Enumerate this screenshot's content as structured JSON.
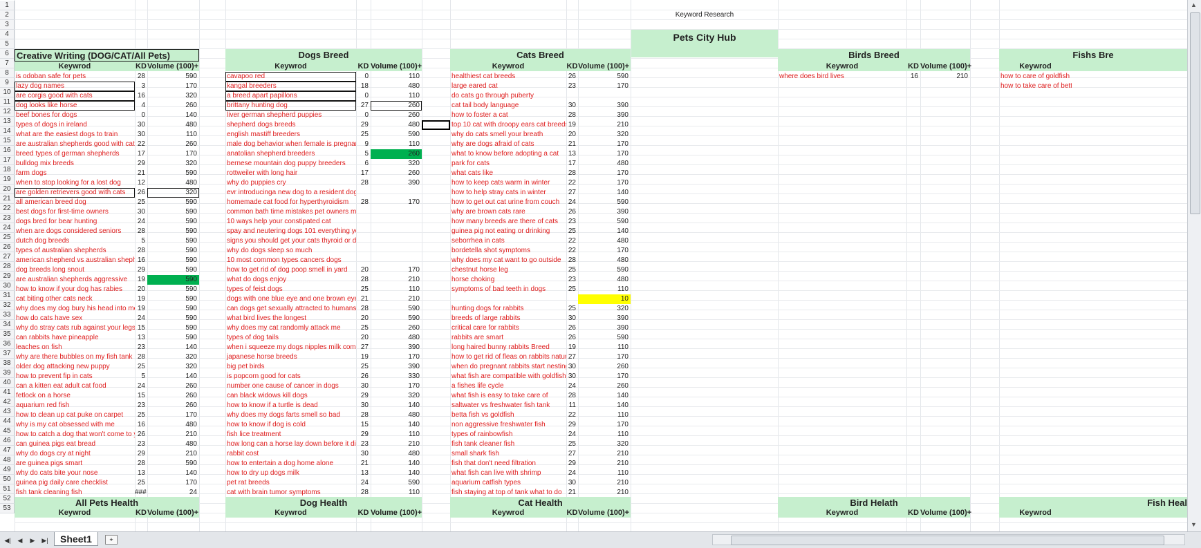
{
  "sheet": {
    "label": "Keyword Research",
    "site": "Pets City Hub",
    "tab": "Sheet1",
    "headers": [
      "Keywrod",
      "KD",
      "Volume (100)+"
    ],
    "sections_top": [
      "Creative Writing (DOG/CAT/All Pets)",
      "Dogs Breed",
      "Cats Breed",
      "Birds Breed",
      "Fishs Bre"
    ],
    "sections_bottom": [
      "All Pets Health",
      "Dog Health",
      "Cat Health",
      "Bird Helath",
      "Fish Heal"
    ],
    "footer_headers": [
      "Keywrod",
      "KD",
      "Volume (100)+"
    ],
    "rows": [
      "1",
      "2",
      "3",
      "4",
      "5",
      "6",
      "7",
      "8",
      "9",
      "10",
      "11",
      "12",
      "13",
      "14",
      "15",
      "16",
      "17",
      "18",
      "19",
      "20",
      "21",
      "22",
      "23",
      "24",
      "25",
      "26",
      "27",
      "28",
      "29",
      "30",
      "31",
      "32",
      "33",
      "34",
      "35",
      "36",
      "37",
      "38",
      "39",
      "40",
      "41",
      "42",
      "43",
      "44",
      "45",
      "46",
      "47",
      "48",
      "49",
      "50",
      "51",
      "52",
      "53"
    ]
  },
  "colors": {
    "header_fill": "#c6efce",
    "keyword_text": "#e02020",
    "green_fill": "#00b050",
    "yellow_fill": "#ffff00"
  },
  "icons": {
    "nav_first": "◀|",
    "nav_prev": "◀",
    "nav_next": "▶",
    "nav_last": "▶|",
    "new_sheet": "new-sheet-icon"
  },
  "columns": {
    "creative": [
      [
        "is odoban safe for pets",
        "28",
        "590"
      ],
      [
        "lazy dog names",
        "3",
        "170"
      ],
      [
        "are corgis good with cats",
        "16",
        "320"
      ],
      [
        "dog looks like horse",
        "4",
        "260"
      ],
      [
        "beef bones for dogs",
        "0",
        "140"
      ],
      [
        "types of dogs in ireland",
        "30",
        "480"
      ],
      [
        "what are the easiest dogs to train",
        "30",
        "110"
      ],
      [
        "are australian shepherds good with cats",
        "22",
        "260"
      ],
      [
        "breed types of german shepherds",
        "17",
        "170"
      ],
      [
        "bulldog mix breeds",
        "29",
        "320"
      ],
      [
        "farm dogs",
        "21",
        "590"
      ],
      [
        "when to stop looking for a lost dog",
        "12",
        "480"
      ],
      [
        "are golden retrievers good with cats",
        "26",
        "320"
      ],
      [
        "all american breed dog",
        "25",
        "590"
      ],
      [
        "best dogs for first-time owners",
        "30",
        "590"
      ],
      [
        "dogs bred for bear hunting",
        "24",
        "590"
      ],
      [
        "when are dogs considered seniors",
        "28",
        "590"
      ],
      [
        "dutch dog breeds",
        "5",
        "590"
      ],
      [
        "types of australian shepherds",
        "28",
        "590"
      ],
      [
        "american shepherd vs australian shephe",
        "16",
        "590"
      ],
      [
        "dog breeds long snout",
        "29",
        "590"
      ],
      [
        "are australian shepherds aggressive",
        "19",
        "590"
      ],
      [
        "how to know if your dog has rabies",
        "20",
        "590"
      ],
      [
        "cat biting other cats neck",
        "19",
        "590"
      ],
      [
        "why does my dog bury his head into me",
        "19",
        "590"
      ],
      [
        "how do cats have sex",
        "24",
        "590"
      ],
      [
        "why do stray cats rub against your legs",
        "15",
        "590"
      ],
      [
        "can rabbits have pineapple",
        "13",
        "590"
      ],
      [
        "leaches on fish",
        "23",
        "140"
      ],
      [
        "why are there bubbles on my fish tank",
        "28",
        "320"
      ],
      [
        "older dog attacking new puppy",
        "25",
        "320"
      ],
      [
        "how to prevent fip in cats",
        "5",
        "140"
      ],
      [
        "can a kitten eat adult cat food",
        "24",
        "260"
      ],
      [
        "fetlock on a horse",
        "15",
        "260"
      ],
      [
        "aquarium red fish",
        "23",
        "260"
      ],
      [
        "how to clean up cat puke on carpet",
        "25",
        "170"
      ],
      [
        "why is my cat obsessed with me",
        "16",
        "480"
      ],
      [
        "how to catch a dog that won't come to yo",
        "26",
        "210"
      ],
      [
        "can guinea pigs eat bread",
        "23",
        "480"
      ],
      [
        "why do dogs cry at night",
        "29",
        "210"
      ],
      [
        "are guinea pigs smart",
        "28",
        "590"
      ],
      [
        "why do cats bite your nose",
        "13",
        "140"
      ],
      [
        "guinea pig daily care checklist",
        "25",
        "170"
      ],
      [
        "fish tank cleaning fish",
        "###",
        "24"
      ]
    ],
    "dogs": [
      [
        "cavapoo red",
        "0",
        "110"
      ],
      [
        "kangal breeders",
        "18",
        "480"
      ],
      [
        "a breed apart papillons",
        "0",
        "110"
      ],
      [
        "brittany hunting dog",
        "27",
        "260"
      ],
      [
        "liver german shepherd puppies",
        "0",
        "260"
      ],
      [
        "shepherd dogs breeds",
        "29",
        "480"
      ],
      [
        "english mastiff breeders",
        "25",
        "590"
      ],
      [
        "male dog behavior when female is pregnant",
        "9",
        "110"
      ],
      [
        "anatolian shepherd breeders",
        "5",
        "260"
      ],
      [
        "bernese mountain dog puppy breeders",
        "6",
        "320"
      ],
      [
        "rottweiler with long hair",
        "17",
        "260"
      ],
      [
        "why do puppies cry",
        "28",
        "390"
      ],
      [
        "evr introducinga new dog to a resident dog",
        "",
        ""
      ],
      [
        "homemade cat food for hyperthyroidism",
        "28",
        "170"
      ],
      [
        "common bath time mistakes pet owners make",
        "",
        ""
      ],
      [
        "10 ways help your constipated cat",
        "",
        ""
      ],
      [
        "spay and neutering dogs 101 everything you need know",
        "",
        ""
      ],
      [
        "signs you should get your cats thyroid or dogs thyroid checked",
        "",
        ""
      ],
      [
        "why do dogs sleep so much",
        "",
        ""
      ],
      [
        "10 most common types cancers dogs",
        "",
        ""
      ],
      [
        "how to get rid of dog poop smell in yard",
        "20",
        "170"
      ],
      [
        "what do dogs enjoy",
        "28",
        "210"
      ],
      [
        "types of feist dogs",
        "25",
        "110"
      ],
      [
        "dogs with one blue eye and one brown eye br",
        "21",
        "210"
      ],
      [
        "can dogs get sexually attracted to humans",
        "28",
        "590"
      ],
      [
        "what bird lives the longest",
        "20",
        "590"
      ],
      [
        "why does my cat randomly attack me",
        "25",
        "260"
      ],
      [
        "types of dog tails",
        "20",
        "480"
      ],
      [
        "when i squeeze my dogs nipples milk comes o",
        "27",
        "390"
      ],
      [
        "japanese horse breeds",
        "19",
        "170"
      ],
      [
        "big pet birds",
        "25",
        "390"
      ],
      [
        "is popcorn good for cats",
        "26",
        "330"
      ],
      [
        "number one cause of cancer in dogs",
        "30",
        "170"
      ],
      [
        "can black widows kill dogs",
        "29",
        "320"
      ],
      [
        "how to know if a turtle is dead",
        "30",
        "140"
      ],
      [
        "why does my dogs farts smell so bad",
        "28",
        "480"
      ],
      [
        "how to know if dog is cold",
        "15",
        "140"
      ],
      [
        "fish lice treatment",
        "29",
        "110"
      ],
      [
        "how long can a horse lay down before it dies",
        "23",
        "210"
      ],
      [
        "rabbit cost",
        "30",
        "480"
      ],
      [
        "how to entertain a dog home alone",
        "21",
        "140"
      ],
      [
        "how to dry up dogs milk",
        "13",
        "140"
      ],
      [
        "pet rat breeds",
        "24",
        "590"
      ],
      [
        "cat with brain tumor symptoms",
        "28",
        "110"
      ]
    ],
    "cats": [
      [
        "healthiest cat breeds",
        "26",
        "590"
      ],
      [
        "large eared cat",
        "23",
        "170"
      ],
      [
        "do cats go through puberty",
        "",
        ""
      ],
      [
        "cat tail body language",
        "30",
        "390"
      ],
      [
        "how to foster a cat",
        "28",
        "390"
      ],
      [
        "top 10 cat with droopy ears cat breeds",
        "19",
        "210"
      ],
      [
        "why do cats smell your breath",
        "20",
        "320"
      ],
      [
        "why are dogs afraid of cats",
        "21",
        "170"
      ],
      [
        "what to know before adopting a cat",
        "13",
        "170"
      ],
      [
        "park for cats",
        "17",
        "480"
      ],
      [
        "what cats like",
        "28",
        "170"
      ],
      [
        "how to keep cats warm in winter",
        "22",
        "170"
      ],
      [
        "how to help stray cats in winter",
        "27",
        "140"
      ],
      [
        "how to get out cat urine from couch",
        "24",
        "590"
      ],
      [
        "why are brown cats rare",
        "26",
        "390"
      ],
      [
        "how many breeds are there of cats",
        "23",
        "590"
      ],
      [
        "guinea pig not eating or drinking",
        "25",
        "140"
      ],
      [
        "seborrhea in cats",
        "22",
        "480"
      ],
      [
        "bordetella shot symptoms",
        "22",
        "170"
      ],
      [
        "why does my cat want to go outside",
        "28",
        "480"
      ],
      [
        "chestnut horse leg",
        "25",
        "590"
      ],
      [
        "horse choking",
        "23",
        "480"
      ],
      [
        "symptoms of bad teeth in dogs",
        "25",
        "110"
      ],
      [
        "",
        "",
        "10"
      ],
      [
        "hunting dogs for rabbits",
        "25",
        "320"
      ],
      [
        "breeds of large rabbits",
        "30",
        "390"
      ],
      [
        "critical care for rabbits",
        "26",
        "390"
      ],
      [
        "rabbits are smart",
        "26",
        "590"
      ],
      [
        "long haired bunny rabbits Breed",
        "19",
        "110"
      ],
      [
        "how to get rid of fleas on rabbits natura",
        "27",
        "170"
      ],
      [
        "when do pregnant rabbits start nesting",
        "30",
        "260"
      ],
      [
        "what fish are compatible with goldfish",
        "30",
        "170"
      ],
      [
        "a fishes life cycle",
        "24",
        "260"
      ],
      [
        "what fish is easy to take care of",
        "28",
        "140"
      ],
      [
        "saltwater vs freshwater fish tank",
        "11",
        "140"
      ],
      [
        "betta fish vs goldfish",
        "22",
        "110"
      ],
      [
        "non aggressive freshwater fish",
        "29",
        "170"
      ],
      [
        "types of rainbowfish",
        "24",
        "110"
      ],
      [
        "fish tank cleaner fish",
        "25",
        "320"
      ],
      [
        "small shark fish",
        "27",
        "210"
      ],
      [
        "fish that don't need filtration",
        "29",
        "210"
      ],
      [
        "what fish can live with shrimp",
        "24",
        "110"
      ],
      [
        "aquarium catfish types",
        "30",
        "210"
      ],
      [
        "fish staying at top of tank what to do",
        "21",
        "210"
      ]
    ],
    "birds": [
      [
        "where does bird lives",
        "16",
        "210"
      ]
    ],
    "fish": [
      [
        "how to care of goldfish",
        "",
        ""
      ],
      [
        "how to take care of betta",
        "",
        ""
      ]
    ]
  }
}
